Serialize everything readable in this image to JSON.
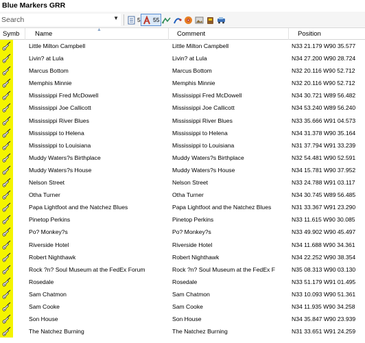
{
  "window": {
    "title": "Blue Markers GRR"
  },
  "toolbar": {
    "search_placeholder": "Search",
    "count_visible": "55",
    "count_filtered": "55"
  },
  "columns": {
    "symbol": "Symb",
    "name": "Name",
    "comment": "Comment",
    "position": "Position"
  },
  "colors": {
    "symbol_bg": "#f4f400",
    "selected_border": "#5b8fd3"
  },
  "rows": [
    {
      "name": "Little Milton Campbell",
      "comment": "Little Milton Campbell",
      "position": "N33 21.179 W90 35.577"
    },
    {
      "name": "Livin? at Lula",
      "comment": "Livin? at Lula",
      "position": "N34 27.200 W90 28.724"
    },
    {
      "name": "Marcus Bottom",
      "comment": "Marcus Bottom",
      "position": "N32 20.116 W90 52.712"
    },
    {
      "name": "Memphis Minnie",
      "comment": "Memphis Minnie",
      "position": "N32 20.116 W90 52.712"
    },
    {
      "name": "Mississippi Fred McDowell",
      "comment": "Mississippi Fred McDowell",
      "position": "N34 30.721 W89 56.482"
    },
    {
      "name": "Mississippi Joe  Callicott",
      "comment": "Mississippi Joe  Callicott",
      "position": "N34 53.240 W89 56.240"
    },
    {
      "name": "Mississippi River Blues",
      "comment": "Mississippi River Blues",
      "position": "N33 35.666 W91 04.573"
    },
    {
      "name": "Mississippi to Helena",
      "comment": "Mississippi to Helena",
      "position": "N34 31.378 W90 35.164"
    },
    {
      "name": "Mississippi to Louisiana",
      "comment": "Mississippi to Louisiana",
      "position": "N31 37.794 W91 33.239"
    },
    {
      "name": "Muddy Waters?s Birthplace",
      "comment": "Muddy Waters?s Birthplace",
      "position": "N32 54.481 W90 52.591"
    },
    {
      "name": "Muddy Waters?s House",
      "comment": "Muddy Waters?s House",
      "position": "N34 15.781 W90 37.952"
    },
    {
      "name": "Nelson Street",
      "comment": "Nelson Street",
      "position": "N33 24.788 W91 03.117"
    },
    {
      "name": "Otha Turner",
      "comment": "Otha Turner",
      "position": "N34 30.745 W89 56.485"
    },
    {
      "name": "Papa Lightfoot and the Natchez Blues",
      "comment": "Papa Lightfoot and the Natchez Blues",
      "position": "N31 33.367 W91 23.290"
    },
    {
      "name": "Pinetop Perkins",
      "comment": "Pinetop Perkins",
      "position": "N33 11.615 W90 30.085"
    },
    {
      "name": "Po? Monkey?s",
      "comment": "Po? Monkey?s",
      "position": "N33 49.902 W90 45.497"
    },
    {
      "name": "Riverside Hotel",
      "comment": "Riverside Hotel",
      "position": "N34 11.688 W90 34.361"
    },
    {
      "name": "Robert Nighthawk",
      "comment": "Robert Nighthawk",
      "position": "N34 22.252 W90 38.354"
    },
    {
      "name": "Rock ?n? Soul Museum at the FedEx Forum",
      "comment": "Rock ?n? Soul Museum at the FedEx F",
      "position": "N35 08.313 W90 03.130"
    },
    {
      "name": "Rosedale",
      "comment": "Rosedale",
      "position": "N33 51.179 W91 01.495"
    },
    {
      "name": "Sam Chatmon",
      "comment": "Sam Chatmon",
      "position": "N33 10.093 W90 51.361"
    },
    {
      "name": "Sam Cooke",
      "comment": "Sam Cooke",
      "position": "N34 11.935 W90 34.258"
    },
    {
      "name": "Son House",
      "comment": "Son House",
      "position": "N34 35.847 W90 23.939"
    },
    {
      "name": "The Natchez Burning",
      "comment": "The Natchez Burning",
      "position": "N31 33.651 W91 24.259"
    }
  ]
}
